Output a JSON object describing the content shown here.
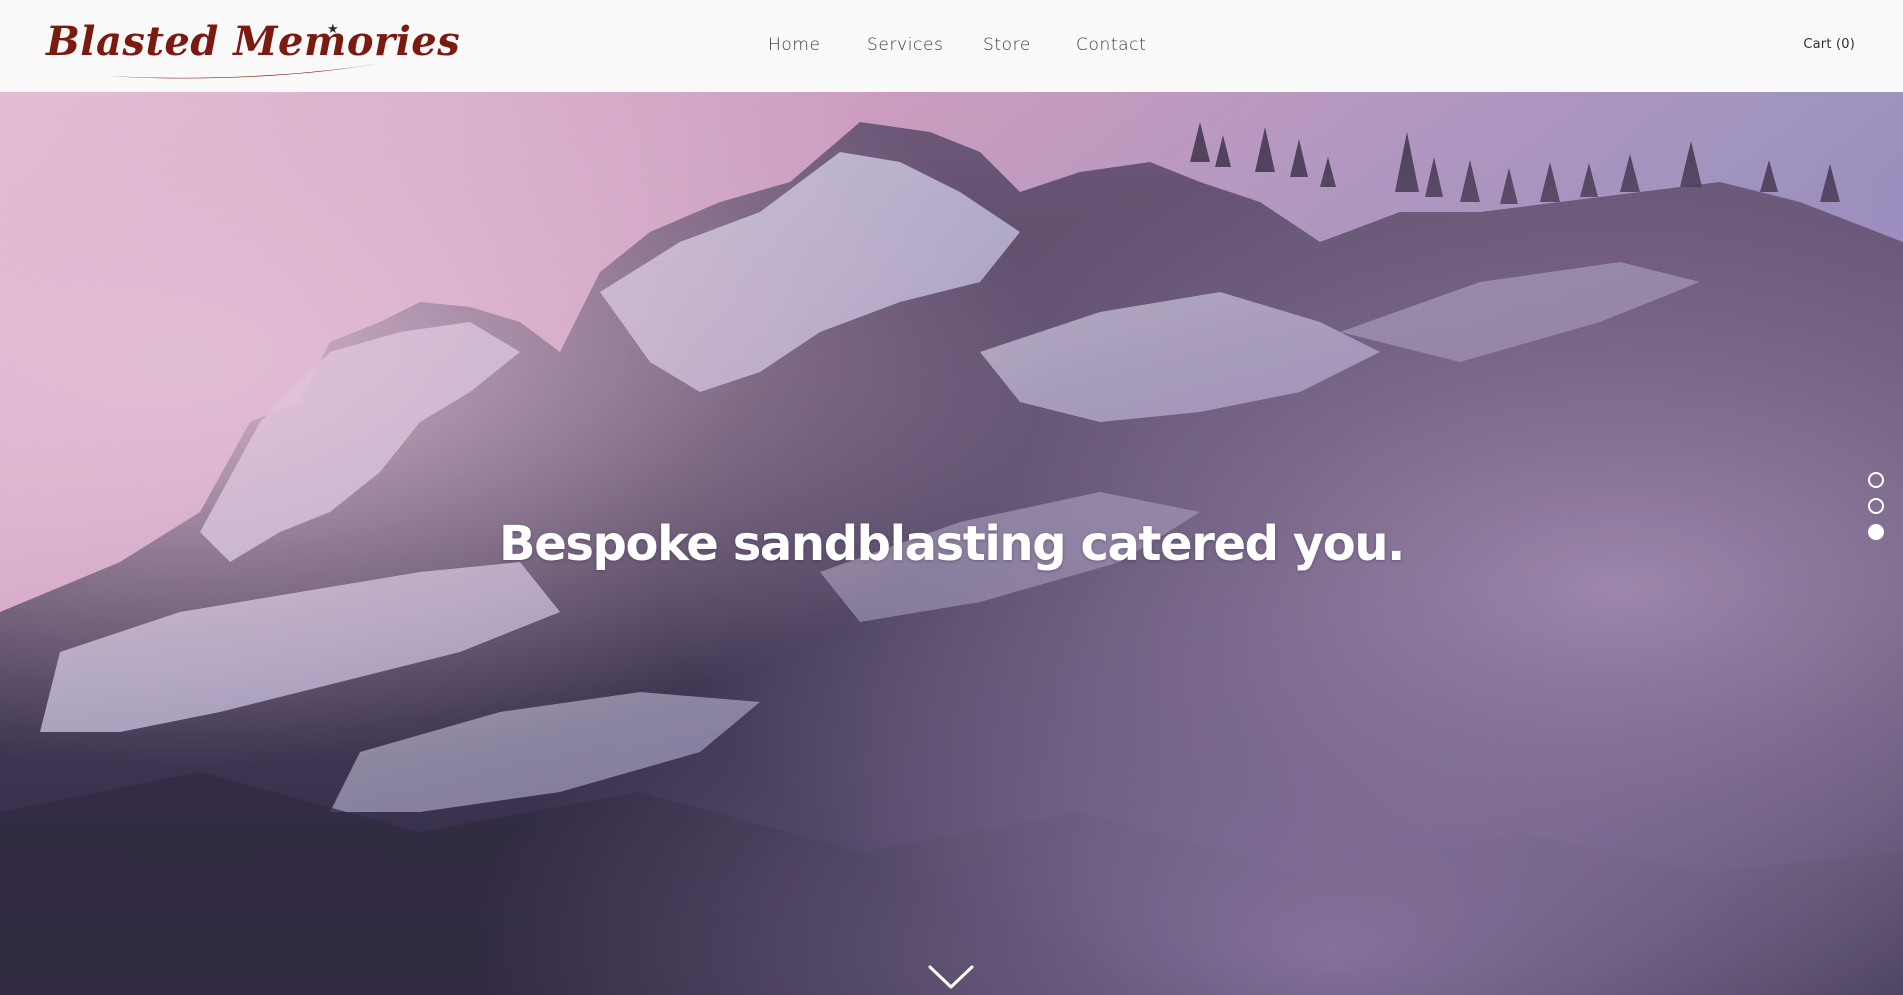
{
  "header": {
    "brand": "Blasted Memories",
    "brand_color": "#7a1a10",
    "nav": [
      {
        "label": "Home"
      },
      {
        "label": "Services"
      },
      {
        "label": "Store"
      },
      {
        "label": "Contact"
      }
    ],
    "cart_label": "Cart (0)"
  },
  "hero": {
    "headline": "Bespoke sandblasting catered you.",
    "slides_total": 3,
    "active_slide": 3,
    "scroll_icon": "chevron-down-icon"
  },
  "colors": {
    "header_bg": "#f9f9f9",
    "nav_text": "#3a3a3a",
    "hero_text": "#ffffff",
    "sky_pink": "#f2c6da",
    "mist_purple": "#9c8cb8"
  }
}
